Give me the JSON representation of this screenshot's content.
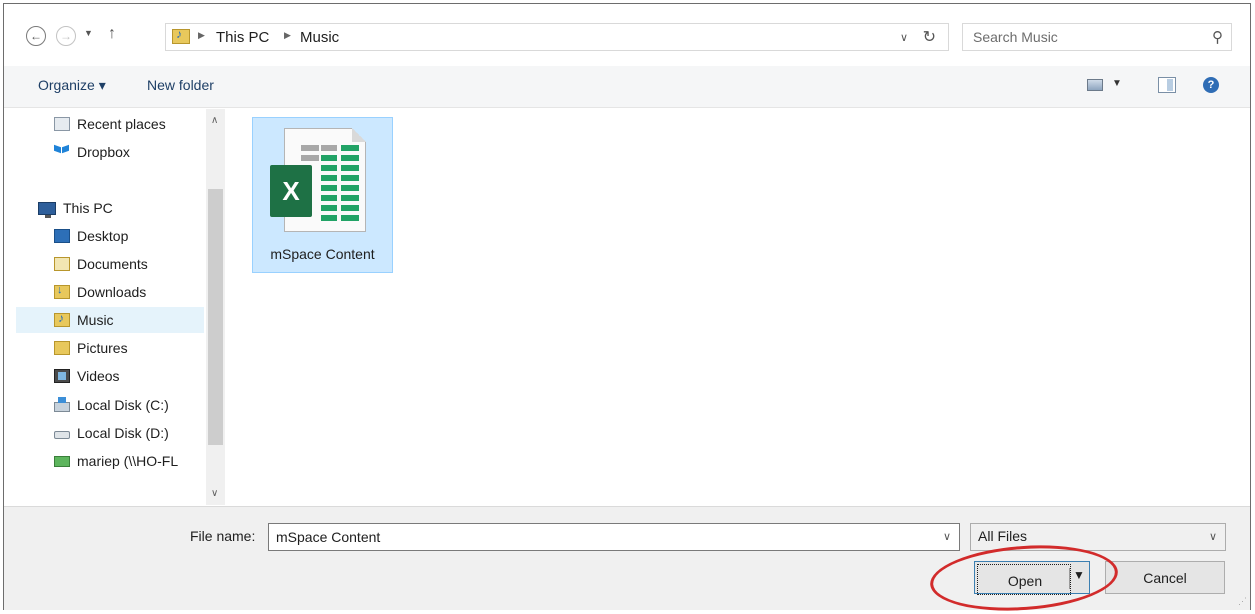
{
  "address": {
    "breadcrumbs": [
      "This PC",
      "Music"
    ]
  },
  "search": {
    "placeholder": "Search Music"
  },
  "toolbar": {
    "organize_label": "Organize ▾",
    "new_folder_label": "New folder"
  },
  "nav": {
    "items": [
      {
        "label": "Recent places",
        "icon": "recent-places-icon"
      },
      {
        "label": "Dropbox",
        "icon": "dropbox-icon"
      },
      {
        "label": "This PC",
        "icon": "computer-icon"
      },
      {
        "label": "Desktop",
        "icon": "desktop-folder-icon"
      },
      {
        "label": "Documents",
        "icon": "documents-folder-icon"
      },
      {
        "label": "Downloads",
        "icon": "downloads-folder-icon"
      },
      {
        "label": "Music",
        "icon": "music-folder-icon",
        "selected": true
      },
      {
        "label": "Pictures",
        "icon": "pictures-folder-icon"
      },
      {
        "label": "Videos",
        "icon": "videos-folder-icon"
      },
      {
        "label": "Local Disk (C:)",
        "icon": "disk-c-icon"
      },
      {
        "label": "Local Disk (D:)",
        "icon": "disk-d-icon"
      },
      {
        "label": "mariep (\\\\HO-FL",
        "icon": "network-drive-icon"
      }
    ]
  },
  "files": [
    {
      "name": "mSpace Content",
      "icon": "excel-file-icon",
      "selected": true
    }
  ],
  "bottom": {
    "file_name_label": "File name:",
    "file_name_value": "mSpace Content",
    "file_type": "All Files",
    "open_label": "Open",
    "cancel_label": "Cancel"
  },
  "colors": {
    "selection": "#cce8ff",
    "annotation": "#d22b2b",
    "excel_green": "#1e7145"
  }
}
